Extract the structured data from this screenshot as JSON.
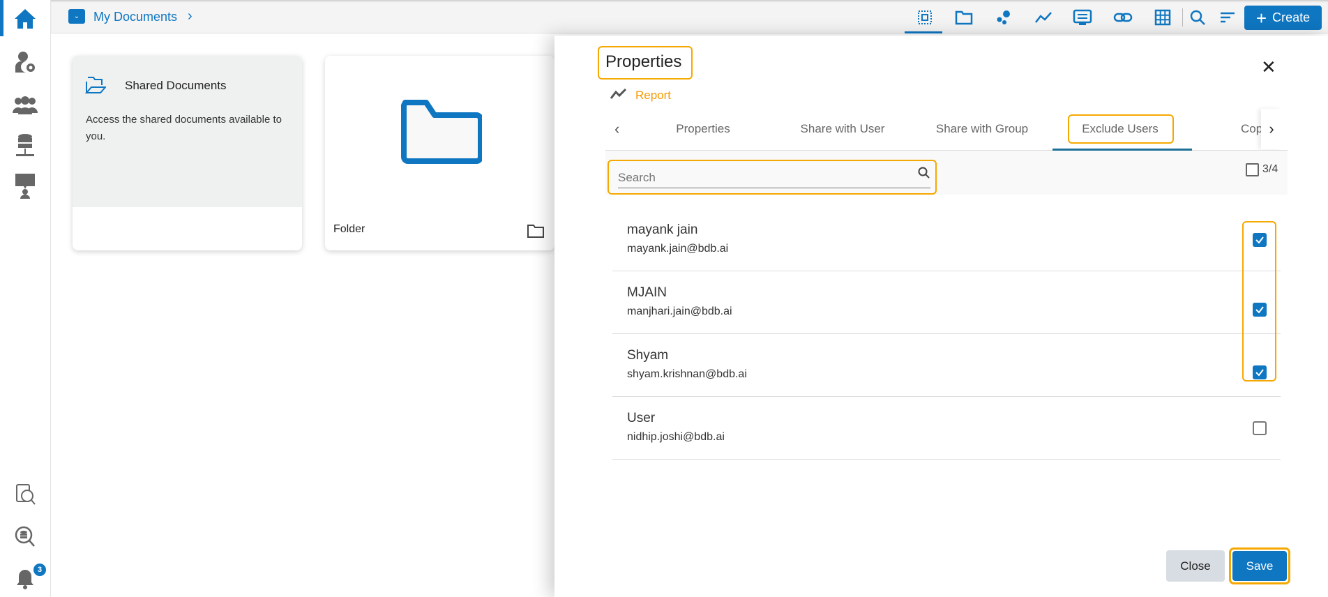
{
  "sidebar": {
    "items": [
      "home",
      "user-settings",
      "groups",
      "data-connectors",
      "presentation"
    ],
    "bottom": [
      "data-catalog",
      "data-search",
      "notifications"
    ],
    "notification_count": "3"
  },
  "breadcrumb": {
    "label": "My Documents"
  },
  "toolbar": {
    "create_label": "Create"
  },
  "cards": [
    {
      "title": "Shared Documents",
      "description": "Access the shared documents available to you."
    },
    {
      "title": "Folder"
    }
  ],
  "panel": {
    "title": "Properties",
    "type_label": "Report",
    "tabs": [
      "Properties",
      "Share with User",
      "Share with Group",
      "Exclude Users",
      "Cop"
    ],
    "active_tab": "Exclude Users",
    "search_placeholder": "Search",
    "selected_count": "3/4",
    "users": [
      {
        "name": "mayank jain",
        "email": "mayank.jain@bdb.ai",
        "checked": true
      },
      {
        "name": "MJAIN",
        "email": "manjhari.jain@bdb.ai",
        "checked": true
      },
      {
        "name": "Shyam",
        "email": "shyam.krishnan@bdb.ai",
        "checked": true
      },
      {
        "name": "User",
        "email": "nidhip.joshi@bdb.ai",
        "checked": false
      }
    ],
    "close_label": "Close",
    "save_label": "Save"
  },
  "colors": {
    "accent": "#0f76c1",
    "highlight": "#f5a800",
    "report": "#f59a00"
  }
}
